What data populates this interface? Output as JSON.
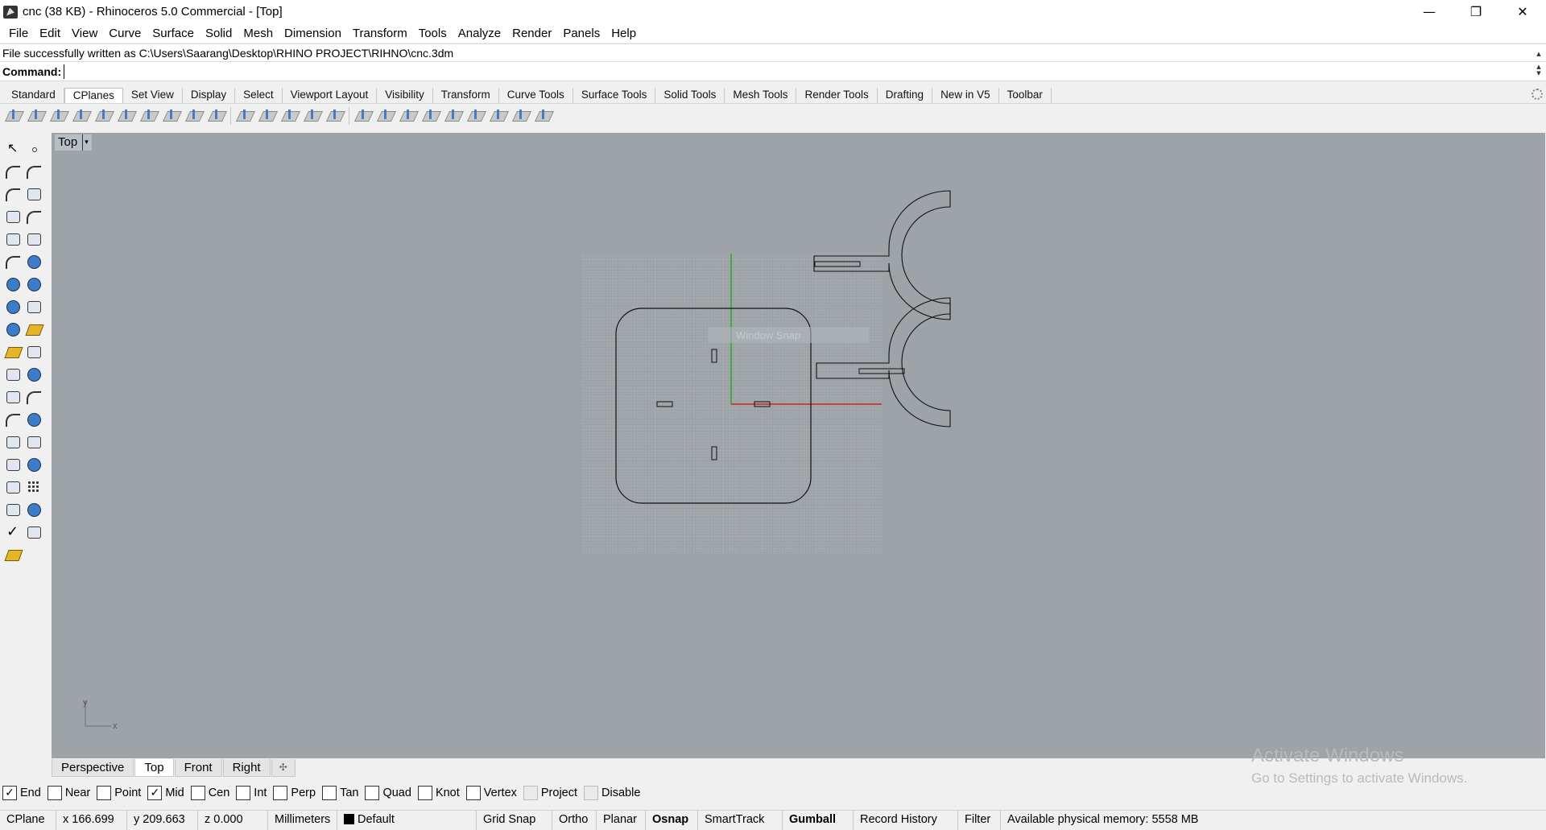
{
  "window": {
    "title": "cnc (38 KB) - Rhinoceros 5.0 Commercial - [Top]",
    "controls": {
      "minimize": "—",
      "restore": "❐",
      "close": "✕"
    }
  },
  "menu": [
    "File",
    "Edit",
    "View",
    "Curve",
    "Surface",
    "Solid",
    "Mesh",
    "Dimension",
    "Transform",
    "Tools",
    "Analyze",
    "Render",
    "Panels",
    "Help"
  ],
  "history": {
    "line": "File successfully written as C:\\Users\\Saarang\\Desktop\\RHINO PROJECT\\RIHNO\\cnc.3dm"
  },
  "command": {
    "label": "Command:",
    "value": ""
  },
  "toolbar_tabs": [
    "Standard",
    "CPlanes",
    "Set View",
    "Display",
    "Select",
    "Viewport Layout",
    "Visibility",
    "Transform",
    "Curve Tools",
    "Surface Tools",
    "Solid Tools",
    "Mesh Tools",
    "Render Tools",
    "Drafting",
    "New in V5",
    "Toolbar"
  ],
  "active_toolbar_tab": "CPlanes",
  "toolbar_icons": [
    "cplane-top-icon",
    "cplane-elevation-icon",
    "cplane-3point-icon",
    "cplane-object-icon",
    "cplane-rotate-icon",
    "cplane-xaxis-icon",
    "cplane-zaxis-icon",
    "cplane-vertical-icon",
    "cplane-curve-icon",
    "cplane-world-icon",
    "cplane-undo-icon",
    "cplane-select-icon",
    "cplane-grid-icon",
    "cplane-save-icon",
    "cplane-open-icon",
    "cplane-view-icon",
    "cplane-set-icon",
    "cplane-origin-icon",
    "cplane-up-icon",
    "cplane-align-icon",
    "cplane-flip-icon",
    "cplane-prev-icon",
    "cplane-next-icon",
    "cplane-named-icon"
  ],
  "viewport": {
    "name": "Top",
    "axis_x": "x",
    "axis_y": "y",
    "snap_tooltip": "Window Snap",
    "background": "#9ea3a8",
    "x_axis_color": "#cc2222",
    "y_axis_color": "#22aa22"
  },
  "view_tabs": [
    "Perspective",
    "Top",
    "Front",
    "Right"
  ],
  "active_view_tab": "Top",
  "view_tab_add": "✣",
  "osnaps": [
    {
      "label": "End",
      "checked": true
    },
    {
      "label": "Near",
      "checked": false
    },
    {
      "label": "Point",
      "checked": false
    },
    {
      "label": "Mid",
      "checked": true
    },
    {
      "label": "Cen",
      "checked": false
    },
    {
      "label": "Int",
      "checked": false
    },
    {
      "label": "Perp",
      "checked": false
    },
    {
      "label": "Tan",
      "checked": false
    },
    {
      "label": "Quad",
      "checked": false
    },
    {
      "label": "Knot",
      "checked": false
    },
    {
      "label": "Vertex",
      "checked": false
    },
    {
      "label": "Project",
      "checked": false,
      "disabled": true
    },
    {
      "label": "Disable",
      "checked": false,
      "disabled": true
    }
  ],
  "watermark": {
    "title": "Activate Windows",
    "subtitle": "Go to Settings to activate Windows."
  },
  "status": {
    "cplane": "CPlane",
    "x": "x 166.699",
    "y": "y 209.663",
    "z": "z 0.000",
    "units": "Millimeters",
    "layer": "Default",
    "grid_snap": "Grid Snap",
    "ortho": "Ortho",
    "planar": "Planar",
    "osnap": "Osnap",
    "smarttrack": "SmartTrack",
    "gumball": "Gumball",
    "record_history": "Record History",
    "filter": "Filter",
    "memory": "Available physical memory: 5558 MB"
  }
}
